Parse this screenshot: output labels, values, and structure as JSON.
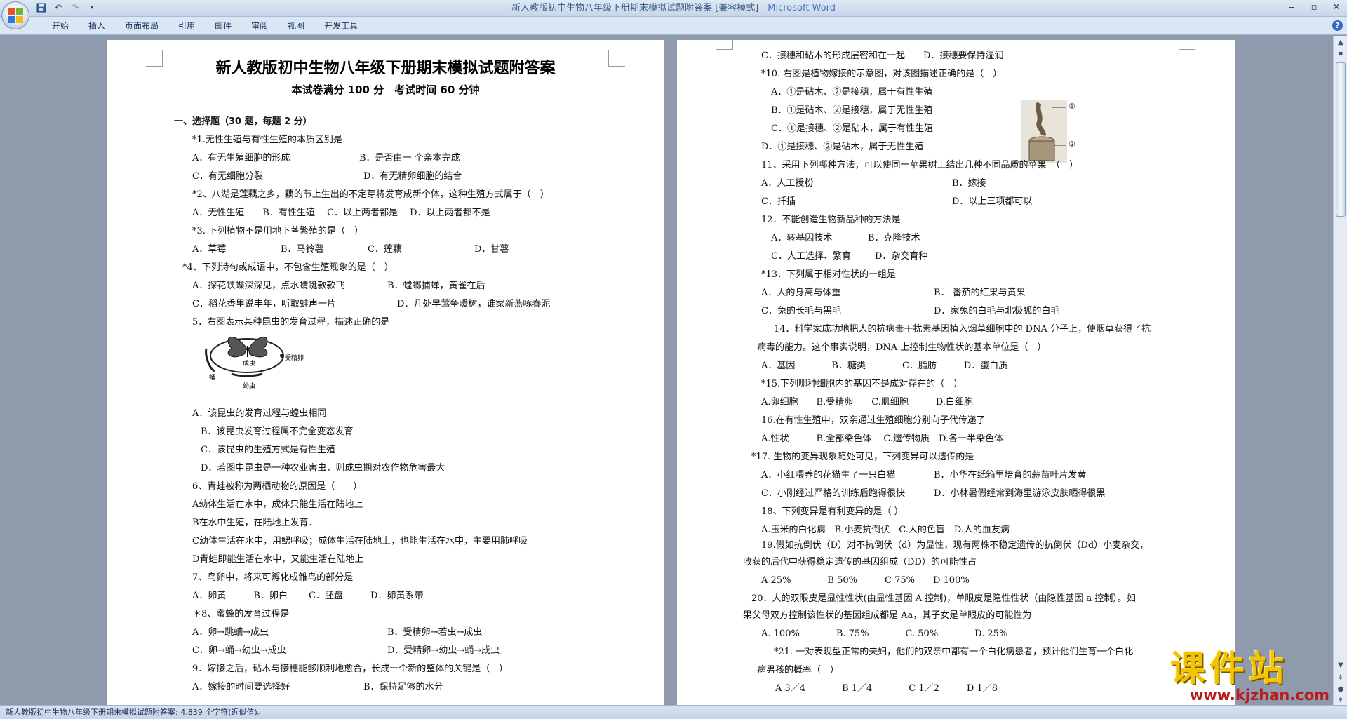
{
  "window": {
    "title": "新人教版初中生物八年级下册期末模拟试题附答案 [兼容模式] - ",
    "app_name": "Microsoft Word"
  },
  "ribbon": {
    "tabs": [
      "开始",
      "插入",
      "页面布局",
      "引用",
      "邮件",
      "审阅",
      "视图",
      "开发工具"
    ]
  },
  "left_page": {
    "title": "新人教版初中生物八年级下册期末模拟试题附答案",
    "subtitle": "本试卷满分 100 分　考试时间 60 分钟",
    "section": "一、选择题（30 题，每题 2 分）",
    "fig_labels": [
      "成虫",
      "受精卵",
      "蛹",
      "幼虫"
    ],
    "lines": [
      "*1.无性生殖与有性生殖的本质区别是",
      "A．有无生殖细胞的形成",
      "B．是否由一 个亲本完成",
      "C．有无细胞分裂",
      "D．有无精卵细胞的结合",
      "*2、八湖是莲藕之乡，藕的节上生出的不定芽将发育成新个体，这种生殖方式属于（　）",
      "A．无性生殖　　B．有性生殖　 C．以上两者都是　 D．以上两者都不是",
      "*3. 下列植物不是用地下茎繁殖的是（　）",
      "A．草莓",
      "B．马铃薯",
      "C．莲藕",
      "D．甘薯",
      "*4、下列诗句或成语中，不包含生殖现象的是（　）",
      "A．探花蛱蝶深深见，点水蜻蜓款款飞",
      "B．螳螂捕蝉，黄雀在后",
      "C．稻花香里说丰年，听取蛙声一片",
      "D．几处早莺争暖树，谁家新燕啄春泥",
      "5．右图表示某种昆虫的发育过程，描述正确的是",
      "A．该昆虫的发育过程与蝗虫相同",
      "B．该昆虫发育过程属不完全变态发育",
      "C．该昆虫的生殖方式是有性生殖",
      "D．若图中昆虫是一种农业害虫，则成虫期对农作物危害最大",
      "6、青蛙被称为两栖动物的原因是（　　）",
      "A幼体生活在水中，成体只能生活在陆地上",
      "B在水中生殖，在陆地上发育．",
      "C幼体生活在水中，用鳃呼吸；成体生活在陆地上，也能生活在水中，主要用肺呼吸",
      "D青蛙即能生活在水中，又能生活在陆地上",
      "7、鸟卵中，将来可孵化成雏鸟的部分是",
      "A．卵黄　　　B．卵白　　 C．胚盘　　　D．卵黄系带",
      "＊8、蜜蜂的发育过程是",
      "A．卵→跳蝻→成虫",
      "B．受精卵→若虫→成虫",
      "C．卵→蛹→幼虫→成虫",
      "D．受精卵→幼虫→蛹→成虫",
      "9．嫁接之后，砧木与接穗能够顺利地愈合，长成一个新的整体的关键是（　）",
      "A．嫁接的时间要选择好",
      "B．保持足够的水分"
    ]
  },
  "right_page": {
    "fig_labels": [
      "①",
      "②"
    ],
    "lines": [
      "C．接穗和砧木的形成层密和在一起　　D．接穗要保持湿润",
      "*10. 右图是植物嫁接的示意图，对该图描述正确的是（　）",
      "A．①是砧木、②是接穗，属于有性生殖",
      "B．①是砧木、②是接穗，属于无性生殖",
      "C．①是接穗、②是砧木，属于有性生殖",
      "D．①是接穗、②是砧木，属于无性生殖",
      "11、采用下列哪种方法，可以使同一苹果树上结出几种不同品质的苹果　（　）",
      "A．人工授粉",
      "B．嫁接",
      "C．扦插",
      "D．以上三项都可以",
      "12．不能创造生物新品种的方法是",
      "A．转基因技术",
      "B．克隆技术",
      "C．人工选择、繁育",
      "D．杂交育种",
      "*13．下列属于相对性状的一组是",
      "A．人的身高与体重",
      "B． 番茄的红果与黄果",
      "C．兔的长毛与黑毛",
      "D．家兔的白毛与北极狐的白毛",
      "14．科学家成功地把人的抗病毒干扰素基因植入烟草细胞中的 DNA 分子上，使烟草获得了抗",
      "病毒的能力。这个事实说明，DNA 上控制生物性状的基本单位是（　）",
      "A．基因　　　　B．糖类　　　　C．脂肪　　　D．蛋白质",
      "*15.下列哪种细胞内的基因不是成对存在的（　）",
      "A.卵细胞　　B.受精卵　　C.肌细胞　　　D.白细胞",
      "16.在有性生殖中，双亲通过生殖细胞分别向子代传递了",
      "A.性状　　　B.全部染色体　 C.遗传物质　D.各一半染色体",
      "*17. 生物的变异现象随处可见，下列变异可以遗传的是",
      "A．小红喂养的花猫生了一只白猫",
      "B．小华在纸箱里培育的蒜苗叶片发黄",
      "C．小刚经过严格的训练后跑得很快",
      "D．小林暑假经常到海里游泳皮肤晒得很黑",
      "18、下列变异是有利变异的是（ ）",
      "A.玉米的白化病　B.小麦抗倒伏　C.人的色盲　D.人的血友病",
      "19.假如抗倒伏（D）对不抗倒伏（d）为显性，现有两株不稳定遗传的抗倒伏（Dd）小麦杂交，",
      "收获的后代中获得稳定遗传的基因组成（DD）的可能性占",
      "A 25%　　　　B 50%　　　C 75%　　D 100%",
      "20．人的双眼皮是显性性状(由显性基因 A 控制)，单眼皮是隐性性状（由隐性基因 a 控制）。如",
      "果父母双方控制该性状的基因组成都是 Aa，其子女是单眼皮的可能性为",
      "A. 100%　　　　B. 75%　　　　C. 50%　　　　D. 25%",
      "*21. 一对表现型正常的夫妇，他们的双亲中都有一个白化病患者，预计他们生育一个白化",
      "病男孩的概率（　）",
      "A 3／4　　　　B 1／4　　　　C 1／2　　　D 1／8"
    ]
  },
  "status": {
    "text": "新人教版初中生物八年级下册期末模拟试题附答案: 4,839 个字符(近似值)。"
  },
  "watermark": {
    "main": "课件站",
    "url": "www.kjzhan.com"
  },
  "colors": {
    "app_title_accent": "#4a73b8",
    "watermark_yellow": "#f5c400",
    "watermark_red": "#b81b1b"
  },
  "icons": [
    "office-button-icon",
    "save-icon",
    "undo-icon",
    "redo-icon",
    "customize-qat-icon",
    "minimize-icon",
    "maximize-icon",
    "close-icon",
    "help-icon"
  ]
}
